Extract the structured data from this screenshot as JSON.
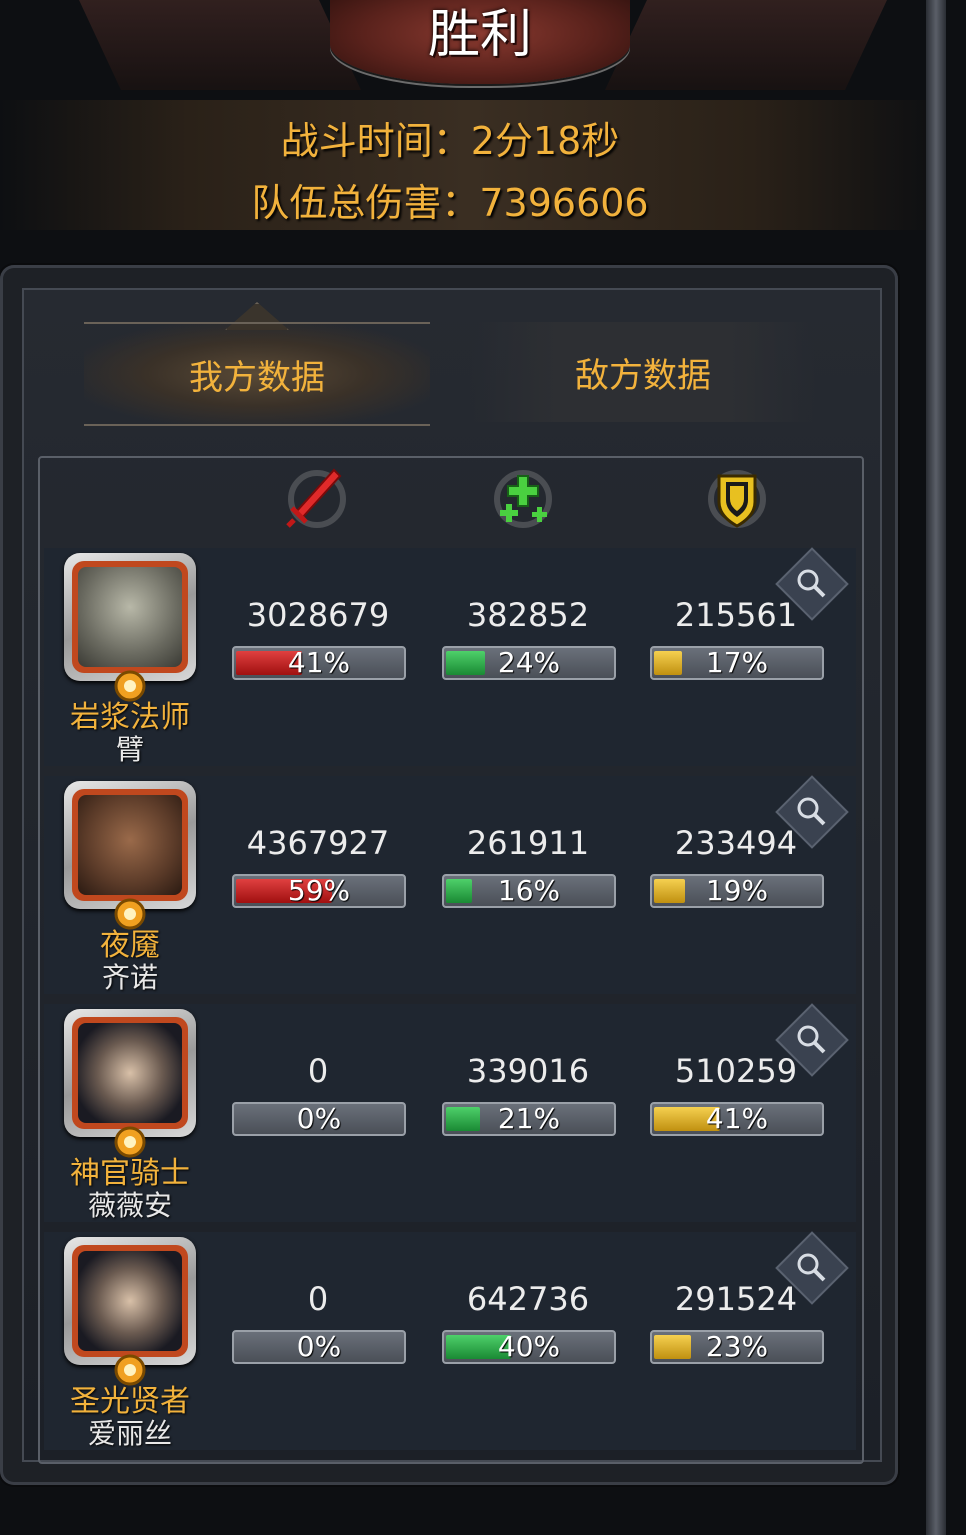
{
  "title": "胜利",
  "battle_time": "战斗时间：2分18秒",
  "team_damage": "队伍总伤害：7396606",
  "tabs": {
    "ours": "我方数据",
    "enemy": "敌方数据"
  },
  "columns": [
    {
      "icon": "sword-icon",
      "color": "#e02a2a"
    },
    {
      "icon": "heal-cross-icon",
      "color": "#4ad040"
    },
    {
      "icon": "shield-icon",
      "color": "#e8c020"
    }
  ],
  "heroes": [
    {
      "class": "岩浆法师",
      "name": "臂",
      "damage": "3028679",
      "damage_pct_label": "41%",
      "damage_pct": 41,
      "heal": "382852",
      "heal_pct_label": "24%",
      "heal_pct": 24,
      "tank": "215561",
      "tank_pct_label": "17%",
      "tank_pct": 17
    },
    {
      "class": "夜魇",
      "name": "齐诺",
      "damage": "4367927",
      "damage_pct_label": "59%",
      "damage_pct": 59,
      "heal": "261911",
      "heal_pct_label": "16%",
      "heal_pct": 16,
      "tank": "233494",
      "tank_pct_label": "19%",
      "tank_pct": 19
    },
    {
      "class": "神官骑士",
      "name": "薇薇安",
      "damage": "0",
      "damage_pct_label": "0%",
      "damage_pct": 0,
      "heal": "339016",
      "heal_pct_label": "21%",
      "heal_pct": 21,
      "tank": "510259",
      "tank_pct_label": "41%",
      "tank_pct": 41
    },
    {
      "class": "圣光贤者",
      "name": "爱丽丝",
      "damage": "0",
      "damage_pct_label": "0%",
      "damage_pct": 0,
      "heal": "642736",
      "heal_pct_label": "40%",
      "heal_pct": 40,
      "tank": "291524",
      "tank_pct_label": "23%",
      "tank_pct": 23
    }
  ]
}
